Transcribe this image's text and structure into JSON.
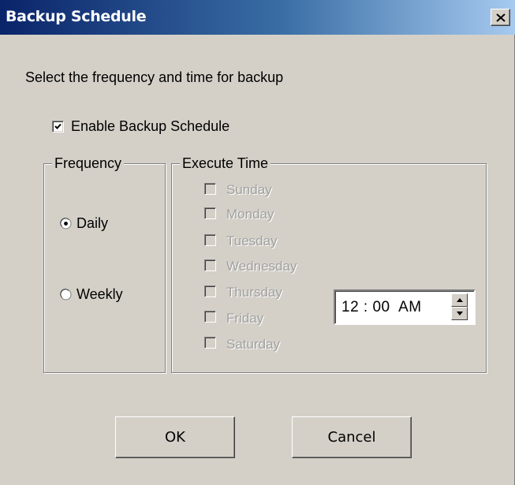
{
  "window": {
    "title": "Backup Schedule",
    "close_icon": "close-icon"
  },
  "instruction": "Select the frequency and time for backup",
  "enable": {
    "label": "Enable Backup Schedule",
    "checked": true
  },
  "frequency": {
    "legend": "Frequency",
    "options": [
      {
        "label": "Daily",
        "selected": true
      },
      {
        "label": "Weekly",
        "selected": false
      }
    ]
  },
  "execute_time": {
    "legend": "Execute Time",
    "days": [
      {
        "label": "Sunday",
        "checked": false,
        "enabled": false
      },
      {
        "label": "Monday",
        "checked": false,
        "enabled": false
      },
      {
        "label": "Tuesday",
        "checked": false,
        "enabled": false
      },
      {
        "label": "Wednesday",
        "checked": false,
        "enabled": false
      },
      {
        "label": "Thursday",
        "checked": false,
        "enabled": false
      },
      {
        "label": "Friday",
        "checked": false,
        "enabled": false
      },
      {
        "label": "Saturday",
        "checked": false,
        "enabled": false
      }
    ],
    "time": "12 : 00  AM"
  },
  "buttons": {
    "ok": "OK",
    "cancel": "Cancel"
  },
  "colors": {
    "dialog_bg": "#d4d0c8",
    "title_bar_start": "#0a246a",
    "title_bar_end": "#a6caf0",
    "disabled_text": "#a0a0a0"
  }
}
